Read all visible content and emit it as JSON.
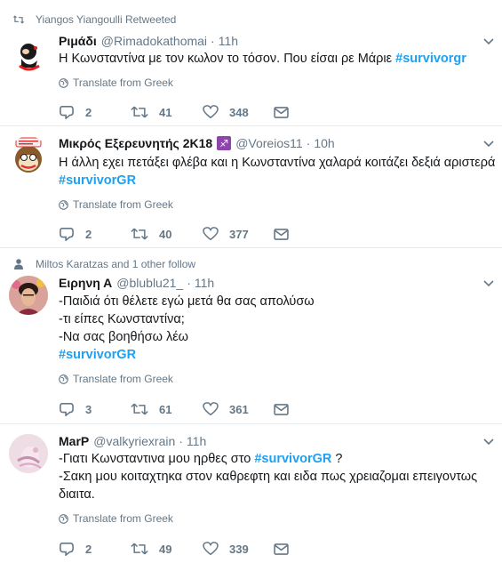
{
  "tweets": [
    {
      "context": "Yiangos Yiangoulli Retweeted",
      "context_icon": "retweet-icon",
      "name": "Ριμάδι",
      "handle": "@Rimadokathomai",
      "time": "11h",
      "lines": [
        [
          {
            "t": "Η Κωνσταντίνα με τον κωλον το τόσον. Που είσαι ρε Μάριε "
          },
          {
            "t": "#survivorgr",
            "h": true
          }
        ]
      ],
      "translate": "Translate from Greek",
      "replies": "2",
      "retweets": "41",
      "likes": "348"
    },
    {
      "name": "Μικρός Εξερευνητής 2K18",
      "badge": "♐",
      "handle": "@Voreios11",
      "time": "10h",
      "lines": [
        [
          {
            "t": "Η άλλη εχει πετάξει φλέβα και η Κωνσταντίνα χαλαρά κοιτάζει δεξιά αριστερά"
          }
        ],
        [
          {
            "t": "#survivorGR",
            "h": true
          }
        ]
      ],
      "translate": "Translate from Greek",
      "replies": "2",
      "retweets": "40",
      "likes": "377"
    },
    {
      "context": "Miltos Karatzas and 1 other follow",
      "context_icon": "person-icon",
      "name": "Ειρηνη Α",
      "handle": "@blublu21_",
      "time": "11h",
      "lines": [
        [
          {
            "t": "-Παιδιά ότι θέλετε εγώ μετά θα σας απολύσω"
          }
        ],
        [
          {
            "t": "-τι είπες Κωνσταντίνα;"
          }
        ],
        [
          {
            "t": "-Να σας βοηθήσω λέω"
          }
        ],
        [
          {
            "t": "#survivorGR",
            "h": true
          }
        ]
      ],
      "translate": "Translate from Greek",
      "replies": "3",
      "retweets": "61",
      "likes": "361"
    },
    {
      "name": "MarP",
      "handle": "@valkyriexrain",
      "time": "11h",
      "lines": [
        [
          {
            "t": "-Γιατι Κωνσταντινα μου ηρθες στο "
          },
          {
            "t": "#survivorGR",
            "h": true
          },
          {
            "t": " ?"
          }
        ],
        [
          {
            "t": "-Σακη μου κοιταχτηκα στον καθρεφτη και ειδα πως χρειαζομαι επειγοντως"
          }
        ],
        [
          {
            "t": "διαιτα."
          }
        ]
      ],
      "translate": "Translate from Greek",
      "replies": "2",
      "retweets": "49",
      "likes": "339"
    }
  ],
  "colors": {
    "hashtag": "#1da1f2",
    "secondary": "#657786",
    "divider": "#e6ecf0"
  }
}
